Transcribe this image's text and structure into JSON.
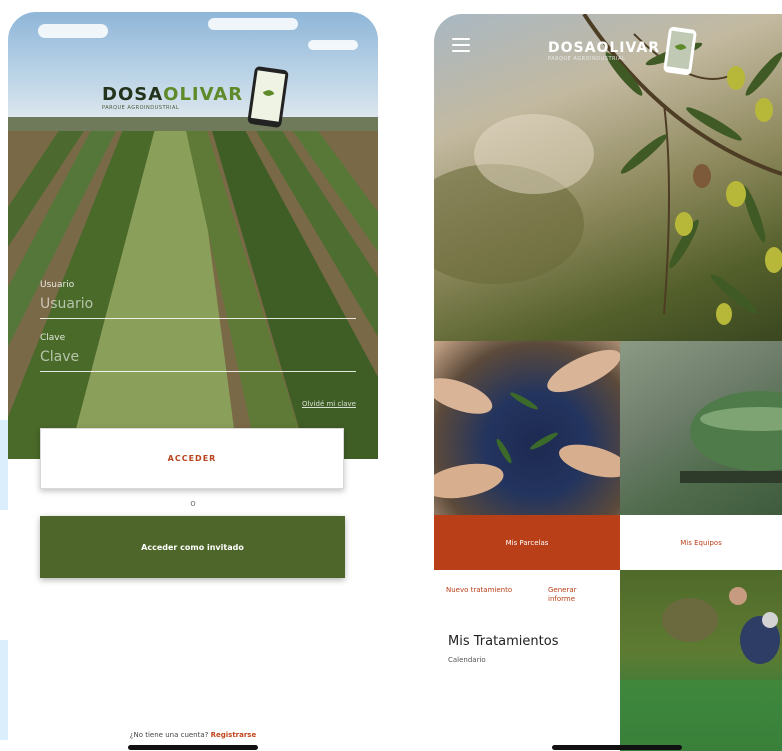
{
  "login_screen": {
    "brand": {
      "part1": "DOSA",
      "part2": "OLIVAR",
      "tagline": "PARQUE AGROINDUSTRIAL"
    },
    "user_label": "Usuario",
    "user_placeholder": "Usuario",
    "password_label": "Clave",
    "password_placeholder": "Clave",
    "forgot_link": "Olvidé mi clave",
    "access_button": "ACCEDER",
    "separator": "o",
    "guest_button": "Acceder como invitado",
    "register_prompt": "¿No tiene una cuenta?",
    "register_link": "Registrarse"
  },
  "dashboard_screen": {
    "brand": {
      "part1": "DOSA",
      "part2": "OLIVAR",
      "tagline": "PARQUE AGROINDUSTRIAL"
    },
    "tile_parcelas": "Mis Parcelas",
    "tile_equipos": "Mis Equipos",
    "new_treatment": "Nuevo tratamiento",
    "generate_report": "Generar informe",
    "treatments_title": "Mis Tratamientos",
    "calendar_link": "Calendario"
  },
  "colors": {
    "brand_dark": "#24331c",
    "brand_green": "#5e8a2a",
    "accent_red": "#b83f18",
    "guest_button_green": "#4e6629"
  },
  "icons": [
    "phone-logo-icon",
    "hamburger-menu-icon"
  ]
}
